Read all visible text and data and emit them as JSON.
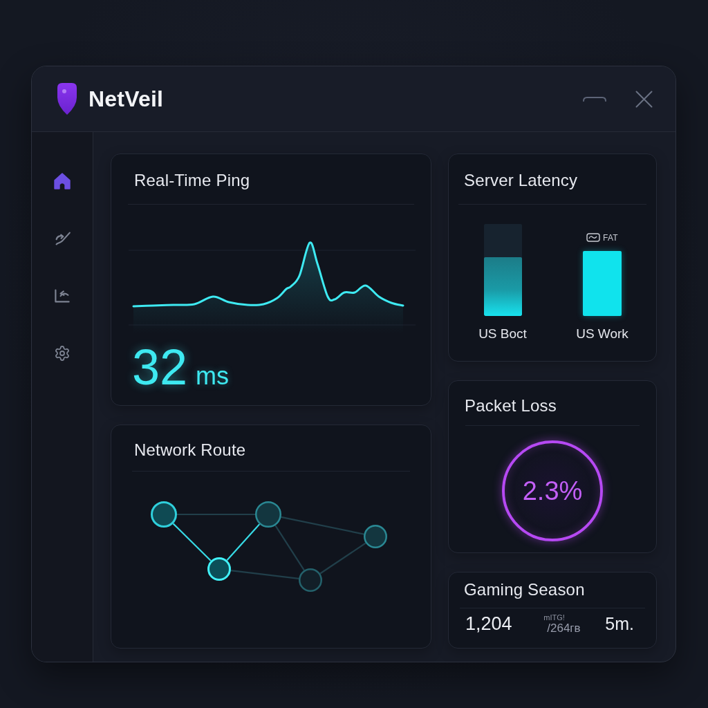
{
  "window": {
    "title": "NetVeil"
  },
  "sidebar": {
    "items": [
      {
        "selected": true
      },
      {
        "selected": false
      },
      {
        "selected": false
      },
      {
        "selected": false
      }
    ]
  },
  "ping": {
    "title": "Real-Time Ping",
    "value": "32",
    "unit": "ms"
  },
  "route": {
    "title": "Network Route"
  },
  "latency": {
    "title": "Server Latency",
    "servers": [
      {
        "label": "US Boct",
        "kind": "track",
        "level": 0.64
      },
      {
        "label": "US Work",
        "kind": "solid",
        "level": 0.71,
        "tag": "FAT"
      }
    ]
  },
  "packet_loss": {
    "title": "Packet Loss",
    "value": "2.3%"
  },
  "session": {
    "title": "Gaming Season",
    "stat_1": "1,204",
    "stat_2_top": "mITG!",
    "stat_2_bottom": "/264гв",
    "stat_3": "5m."
  }
}
